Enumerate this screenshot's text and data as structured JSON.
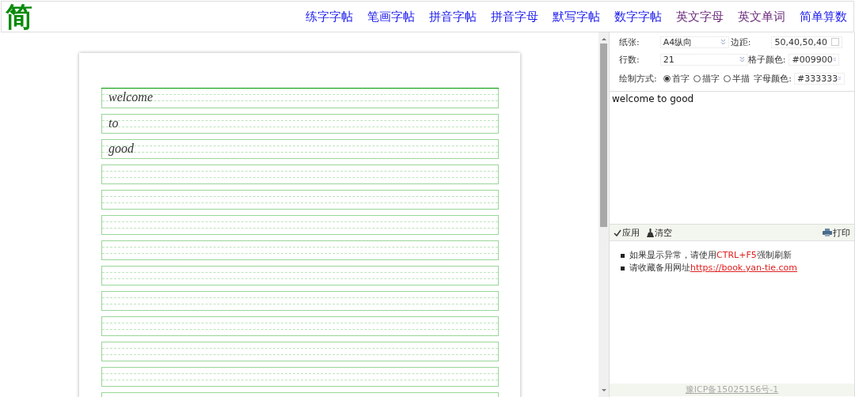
{
  "logo": {
    "text": "简"
  },
  "nav": [
    {
      "label": "练字字帖",
      "visited": false
    },
    {
      "label": "笔画字帖",
      "visited": false
    },
    {
      "label": "拼音字帖",
      "visited": false
    },
    {
      "label": "拼音字母",
      "visited": false
    },
    {
      "label": "默写字帖",
      "visited": false
    },
    {
      "label": "数字字帖",
      "visited": false
    },
    {
      "label": "英文字母",
      "visited": true
    },
    {
      "label": "英文单词",
      "visited": true
    },
    {
      "label": "简单算数",
      "visited": false
    }
  ],
  "sheet": {
    "rows": [
      "welcome",
      "to",
      "good"
    ]
  },
  "settings": {
    "paper": {
      "label": "纸张:",
      "value": "A4纵向"
    },
    "margin": {
      "label": "边距:",
      "value": "50,40,50,40"
    },
    "rows": {
      "label": "行数:",
      "value": "21"
    },
    "grid_color": {
      "label": "格子颜色:",
      "value": "#009900"
    },
    "draw_mode": {
      "label": "绘制方式:",
      "options": [
        {
          "label": "首字",
          "selected": true
        },
        {
          "label": "描字",
          "selected": false
        },
        {
          "label": "半描",
          "selected": false
        }
      ]
    },
    "letter_color": {
      "label": "字母颜色:",
      "value": "#333333"
    }
  },
  "text_input": {
    "value": "welcome to good"
  },
  "toolbar": [
    {
      "label": "应用",
      "kind": "check"
    },
    {
      "label": "清空",
      "kind": "broom"
    },
    {
      "label": "打印",
      "kind": "print"
    }
  ],
  "notes": [
    {
      "before": "如果显示异常，请使用",
      "highlight": "CTRL+F5",
      "after": "强制刷新"
    },
    {
      "before": "请收藏备用网址",
      "link": "https://book.yan-tie.com"
    }
  ],
  "footer": {
    "text": "豫ICP备15025156号-1"
  }
}
